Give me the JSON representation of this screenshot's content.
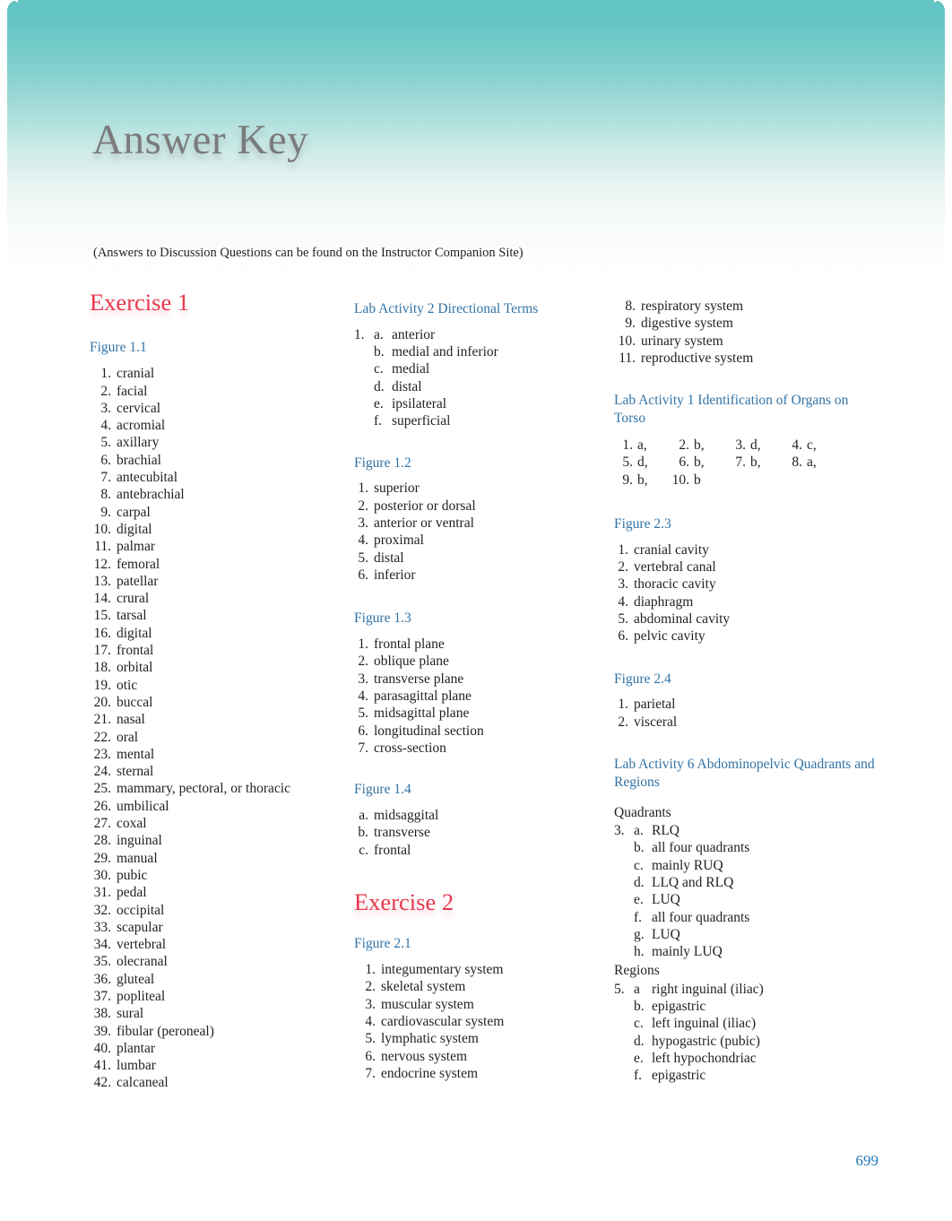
{
  "page": {
    "title": "Answer Key",
    "note": "(Answers to Discussion Questions can be found on the Instructor Companion Site)",
    "number": "699",
    "accent_red": "#e8384f",
    "accent_blue": "#3173a6",
    "header_teal": "#62c4c3",
    "page_number_color": "#1f7ab5"
  },
  "column1": {
    "exercise_heading": "Exercise 1",
    "figure_1_1": {
      "heading": "Figure 1.1",
      "items": [
        {
          "n": "1.",
          "text": "cranial"
        },
        {
          "n": "2.",
          "text": "facial"
        },
        {
          "n": "3.",
          "text": "cervical"
        },
        {
          "n": "4.",
          "text": "acromial"
        },
        {
          "n": "5.",
          "text": "axillary"
        },
        {
          "n": "6.",
          "text": "brachial"
        },
        {
          "n": "7.",
          "text": "antecubital"
        },
        {
          "n": "8.",
          "text": "antebrachial"
        },
        {
          "n": "9.",
          "text": "carpal"
        },
        {
          "n": "10.",
          "text": "digital"
        },
        {
          "n": "11.",
          "text": "palmar"
        },
        {
          "n": "12.",
          "text": "femoral"
        },
        {
          "n": "13.",
          "text": "patellar"
        },
        {
          "n": "14.",
          "text": "crural"
        },
        {
          "n": "15.",
          "text": "tarsal"
        },
        {
          "n": "16.",
          "text": "digital"
        },
        {
          "n": "17.",
          "text": "frontal"
        },
        {
          "n": "18.",
          "text": "orbital"
        },
        {
          "n": "19.",
          "text": "otic"
        },
        {
          "n": "20.",
          "text": "buccal"
        },
        {
          "n": "21.",
          "text": "nasal"
        },
        {
          "n": "22.",
          "text": "oral"
        },
        {
          "n": "23.",
          "text": "mental"
        },
        {
          "n": "24.",
          "text": "sternal"
        },
        {
          "n": "25.",
          "text": "mammary, pectoral, or thoracic"
        },
        {
          "n": "26.",
          "text": "umbilical"
        },
        {
          "n": "27.",
          "text": "coxal"
        },
        {
          "n": "28.",
          "text": "inguinal"
        },
        {
          "n": "29.",
          "text": "manual"
        },
        {
          "n": "30.",
          "text": "pubic"
        },
        {
          "n": "31.",
          "text": "pedal"
        },
        {
          "n": "32.",
          "text": "occipital"
        },
        {
          "n": "33.",
          "text": "scapular"
        },
        {
          "n": "34.",
          "text": "vertebral"
        },
        {
          "n": "35.",
          "text": "olecranal"
        },
        {
          "n": "36.",
          "text": "gluteal"
        },
        {
          "n": "37.",
          "text": "popliteal"
        },
        {
          "n": "38.",
          "text": "sural"
        },
        {
          "n": "39.",
          "text": "fibular (peroneal)"
        },
        {
          "n": "40.",
          "text": "plantar"
        },
        {
          "n": "41.",
          "text": "lumbar"
        },
        {
          "n": "42.",
          "text": "calcaneal"
        }
      ]
    }
  },
  "column2": {
    "lab_activity_2": {
      "heading": "Lab Activity 2 Directional Terms",
      "items": [
        {
          "lead": "1.",
          "ltr": "a.",
          "text": "anterior"
        },
        {
          "lead": "",
          "ltr": "b.",
          "text": "medial and inferior"
        },
        {
          "lead": "",
          "ltr": "c.",
          "text": "medial"
        },
        {
          "lead": "",
          "ltr": "d.",
          "text": "distal"
        },
        {
          "lead": "",
          "ltr": "e.",
          "text": "ipsilateral"
        },
        {
          "lead": "",
          "ltr": "f.",
          "text": "superficial"
        }
      ]
    },
    "figure_1_2": {
      "heading": "Figure 1.2",
      "items": [
        {
          "n": "1.",
          "text": "superior"
        },
        {
          "n": "2.",
          "text": "posterior or dorsal"
        },
        {
          "n": "3.",
          "text": "anterior or ventral"
        },
        {
          "n": "4.",
          "text": "proximal"
        },
        {
          "n": "5.",
          "text": "distal"
        },
        {
          "n": "6.",
          "text": "inferior"
        }
      ]
    },
    "figure_1_3": {
      "heading": "Figure 1.3",
      "items": [
        {
          "n": "1.",
          "text": "frontal plane"
        },
        {
          "n": "2.",
          "text": "oblique plane"
        },
        {
          "n": "3.",
          "text": "transverse plane"
        },
        {
          "n": "4.",
          "text": "parasagittal plane"
        },
        {
          "n": "5.",
          "text": "midsagittal plane"
        },
        {
          "n": "6.",
          "text": "longitudinal section"
        },
        {
          "n": "7.",
          "text": "cross-section"
        }
      ]
    },
    "figure_1_4": {
      "heading": "Figure 1.4",
      "items": [
        {
          "n": "a.",
          "text": "midsaggital"
        },
        {
          "n": "b.",
          "text": "transverse"
        },
        {
          "n": "c.",
          "text": "frontal"
        }
      ]
    },
    "exercise_heading": "Exercise 2",
    "figure_2_1": {
      "heading": "Figure 2.1",
      "items": [
        {
          "n": "1.",
          "text": "integumentary system"
        },
        {
          "n": "2.",
          "text": "skeletal system"
        },
        {
          "n": "3.",
          "text": "muscular system"
        },
        {
          "n": "4.",
          "text": "cardiovascular system"
        },
        {
          "n": "5.",
          "text": "lymphatic system"
        },
        {
          "n": "6.",
          "text": "nervous system"
        },
        {
          "n": "7.",
          "text": "endocrine system"
        }
      ]
    }
  },
  "column3": {
    "figure_2_1_cont": {
      "items": [
        {
          "n": "8.",
          "text": "respiratory system"
        },
        {
          "n": "9.",
          "text": "digestive system"
        },
        {
          "n": "10.",
          "text": "urinary system"
        },
        {
          "n": "11.",
          "text": "reproductive system"
        }
      ]
    },
    "lab_activity_1": {
      "heading": "Lab Activity 1 Identification of Organs on Torso",
      "rows": [
        [
          {
            "n": "1.",
            "v": "a,"
          },
          {
            "n": "2.",
            "v": "b,"
          },
          {
            "n": "3.",
            "v": "d,"
          },
          {
            "n": "4.",
            "v": "c,"
          }
        ],
        [
          {
            "n": "5.",
            "v": "d,"
          },
          {
            "n": "6.",
            "v": "b,"
          },
          {
            "n": "7.",
            "v": "b,"
          },
          {
            "n": "8.",
            "v": "a,"
          }
        ],
        [
          {
            "n": "9.",
            "v": "b,"
          },
          {
            "n": "10.",
            "v": "b"
          }
        ]
      ]
    },
    "figure_2_3": {
      "heading": "Figure 2.3",
      "items": [
        {
          "n": "1.",
          "text": "cranial cavity"
        },
        {
          "n": "2.",
          "text": "vertebral canal"
        },
        {
          "n": "3.",
          "text": "thoracic cavity"
        },
        {
          "n": "4.",
          "text": "diaphragm"
        },
        {
          "n": "5.",
          "text": "abdominal cavity"
        },
        {
          "n": "6.",
          "text": "pelvic cavity"
        }
      ]
    },
    "figure_2_4": {
      "heading": "Figure 2.4",
      "items": [
        {
          "n": "1.",
          "text": "parietal"
        },
        {
          "n": "2.",
          "text": "visceral"
        }
      ]
    },
    "lab_activity_6": {
      "heading": "Lab Activity 6 Abdominopelvic Quadrants and Regions",
      "quadrants_label": "Quadrants",
      "quadrants": [
        {
          "lead": "3.",
          "ltr": "a.",
          "text": "RLQ"
        },
        {
          "lead": "",
          "ltr": "b.",
          "text": "all four quadrants"
        },
        {
          "lead": "",
          "ltr": "c.",
          "text": "mainly RUQ"
        },
        {
          "lead": "",
          "ltr": "d.",
          "text": "LLQ and RLQ"
        },
        {
          "lead": "",
          "ltr": "e.",
          "text": "LUQ"
        },
        {
          "lead": "",
          "ltr": "f.",
          "text": "all four quadrants"
        },
        {
          "lead": "",
          "ltr": "g.",
          "text": "LUQ"
        },
        {
          "lead": "",
          "ltr": "h.",
          "text": "mainly LUQ"
        }
      ],
      "regions_label": "Regions",
      "regions": [
        {
          "lead": "5.",
          "ltr": "a",
          "text": "right inguinal (iliac)"
        },
        {
          "lead": "",
          "ltr": "b.",
          "text": "epigastric"
        },
        {
          "lead": "",
          "ltr": "c.",
          "text": "left inguinal (iliac)"
        },
        {
          "lead": "",
          "ltr": "d.",
          "text": "hypogastric (pubic)"
        },
        {
          "lead": "",
          "ltr": "e.",
          "text": "left hypochondriac"
        },
        {
          "lead": "",
          "ltr": "f.",
          "text": "epigastric"
        }
      ]
    }
  }
}
